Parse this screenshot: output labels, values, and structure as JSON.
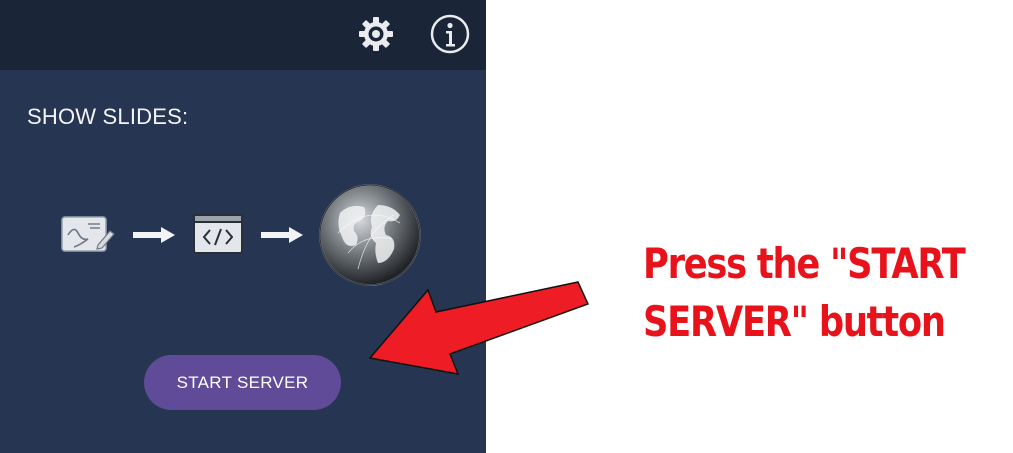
{
  "app": {
    "icons": {
      "settings": "gear-icon",
      "info": "info-icon"
    },
    "section_title": "SHOW SLIDES:",
    "flow_icons": [
      "slide-drawing-icon",
      "arrow-right-icon",
      "code-window-icon",
      "arrow-right-icon",
      "globe-icon"
    ],
    "start_button_label": "START SERVER",
    "colors": {
      "panel": "#263551",
      "top_bar": "#1b2538",
      "button": "#5f4b98"
    }
  },
  "annotation": {
    "lines": [
      "Press the \"START",
      "SERVER\" button"
    ],
    "color": "#e8121b"
  }
}
